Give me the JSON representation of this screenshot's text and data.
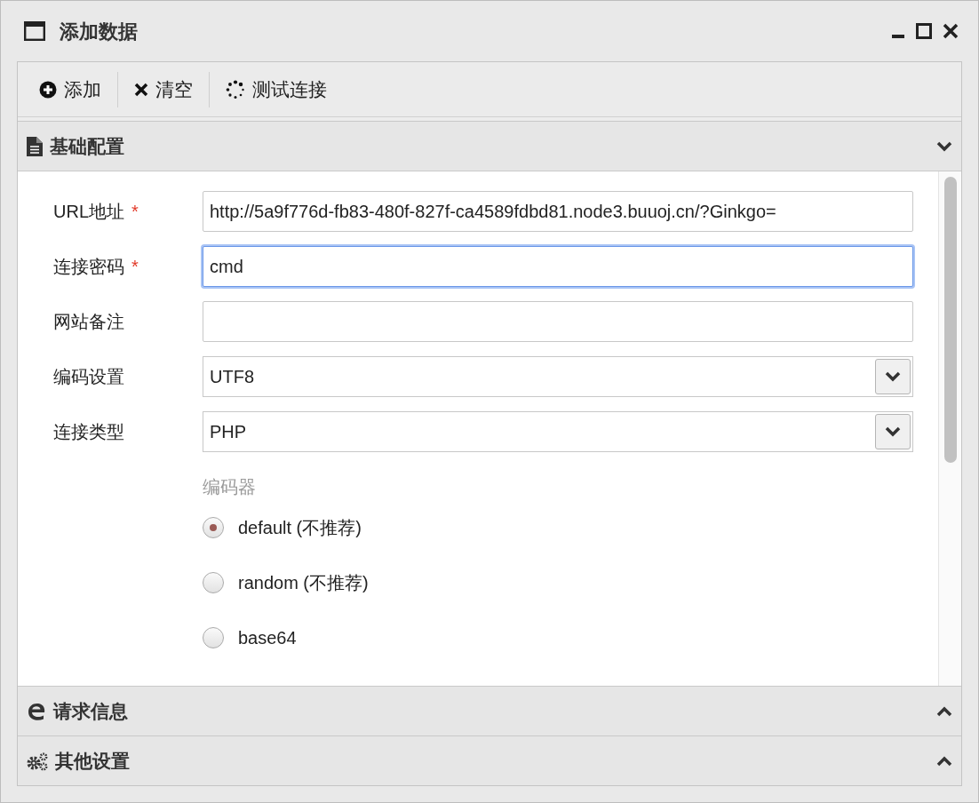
{
  "window": {
    "title": "添加数据"
  },
  "toolbar": [
    {
      "kind": "add",
      "label": "添加"
    },
    {
      "kind": "clear",
      "label": "清空"
    },
    {
      "kind": "test",
      "label": "测试连接"
    }
  ],
  "sections": [
    {
      "kind": "basic",
      "title": "基础配置",
      "expanded": true
    },
    {
      "kind": "request",
      "title": "请求信息",
      "expanded": false
    },
    {
      "kind": "other",
      "title": "其他设置",
      "expanded": false
    }
  ],
  "form": {
    "fields": [
      {
        "kind": "text",
        "label": "URL地址",
        "required_mark": "*",
        "value": "http://5a9f776d-fb83-480f-827f-ca4589fdbd81.node3.buuoj.cn/?Ginkgo=",
        "focused": false
      },
      {
        "kind": "text",
        "label": "连接密码",
        "required_mark": "*",
        "value": "cmd",
        "focused": true
      },
      {
        "kind": "text",
        "label": "网站备注",
        "focused": false
      },
      {
        "kind": "select",
        "label": "编码设置",
        "value": "UTF8",
        "focused": false
      },
      {
        "kind": "select",
        "label": "连接类型",
        "value": "PHP",
        "focused": false
      }
    ],
    "encoder": {
      "heading": "编码器",
      "options": [
        {
          "label": "default (不推荐)",
          "selected": true
        },
        {
          "label": "random (不推荐)",
          "selected": false
        },
        {
          "label": "base64",
          "selected": false
        }
      ]
    }
  }
}
